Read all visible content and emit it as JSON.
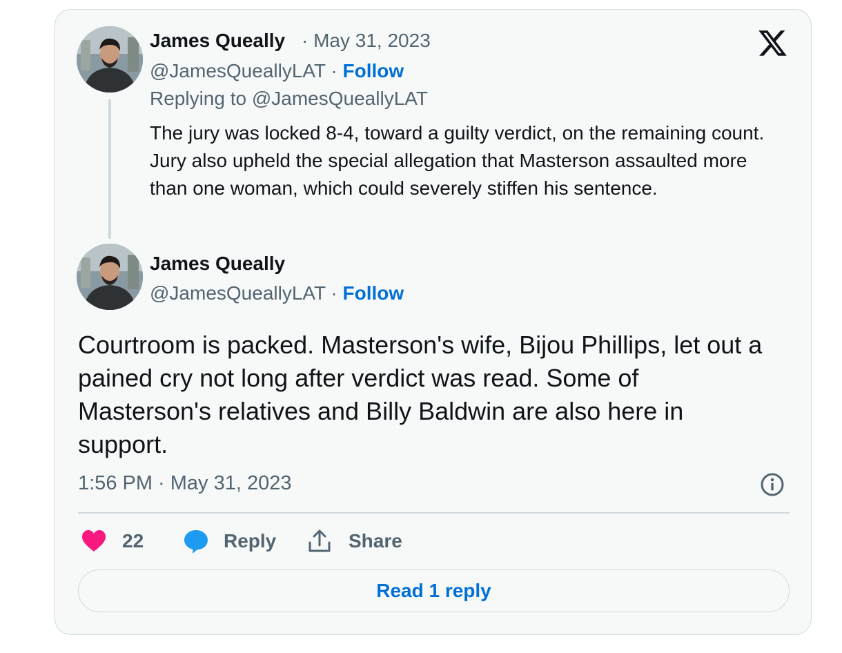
{
  "colors": {
    "link_blue": "#006fd6",
    "muted": "#536471",
    "text": "#0f1419",
    "heart": "#f91880",
    "reply_bubble": "#1d9bf0",
    "card_bg": "#f7f9f9",
    "border": "#cfd9de"
  },
  "parent_tweet": {
    "author_name": "James Queally",
    "separator": "·",
    "date": "May 31, 2023",
    "handle": "@JamesQueallyLAT",
    "follow_label": "Follow",
    "replying_to": "Replying to @JamesQueallyLAT",
    "text": "The jury was locked 8-4, toward a guilty verdict, on the remaining count. Jury also upheld the special allegation that Masterson assaulted more than one woman, which could severely stiffen his sentence."
  },
  "main_tweet": {
    "author_name": "James Queally",
    "handle": "@JamesQueallyLAT",
    "separator": "·",
    "follow_label": "Follow",
    "text": "Courtroom is packed. Masterson's wife, Bijou Phillips, let out a pained cry not long after verdict was read. Some of Masterson's relatives and Billy Baldwin are also here in support.",
    "timestamp": "1:56 PM · May 31, 2023"
  },
  "actions": {
    "like_count": "22",
    "reply_label": "Reply",
    "share_label": "Share"
  },
  "read_replies_label": "Read 1 reply",
  "icons": [
    "x-logo-icon",
    "info-icon",
    "heart-icon",
    "reply-bubble-icon",
    "share-icon"
  ]
}
